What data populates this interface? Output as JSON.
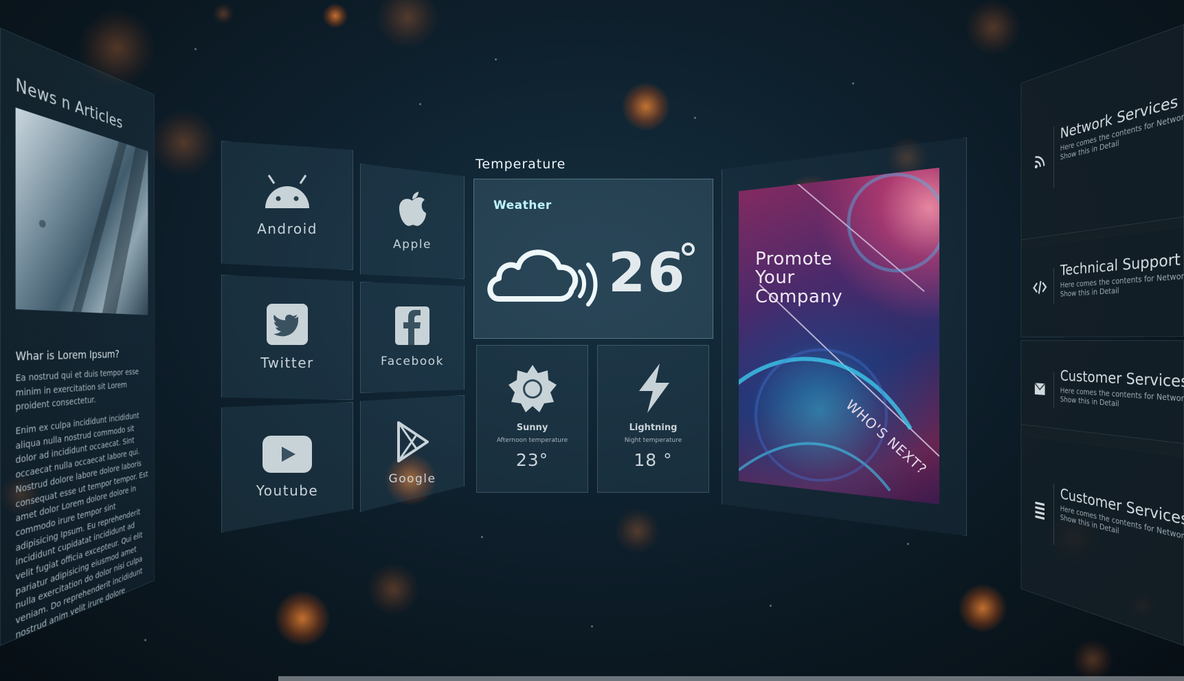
{
  "news": {
    "title": "News n Articles",
    "heading": "Whar is Lorem Ipsum?",
    "para1": "Ea nostrud qui et duis tempor esse minim in exercitation sit Lorem proident consectetur.",
    "para2": "Enim ex culpa incididunt incididunt aliqua nulla nostrud commodo sit dolor ad incididunt occaecat. Sint occaecat nulla occaecat labore qui. Nostrud dolore labore dolore laboris consequat esse ut tempor tempor. Est amet dolor Lorem dolore dolore in commodo irure tempor sint adipisicing Ipsum. Eu reprehenderit incididunt cupidatat incididunt ad velit fugiat officia excepteur. Qui elit pariatur adipisicing eiusmod amet nulla exercitation do dolor nisi culpa veniam. Do reprehenderit incididunt nostrud anim velit irure dolore"
  },
  "apps": [
    {
      "label": "Android",
      "icon": "android-icon"
    },
    {
      "label": "Apple",
      "icon": "apple-icon"
    },
    {
      "label": "Twitter",
      "icon": "twitter-icon"
    },
    {
      "label": "Facebook",
      "icon": "facebook-icon"
    },
    {
      "label": "Youtube",
      "icon": "youtube-icon"
    },
    {
      "label": "Google",
      "icon": "google-play-icon"
    }
  ],
  "temperature": {
    "section_label": "Temperature",
    "card_label": "Weather",
    "current": "26",
    "current_icon": "cloud-icon",
    "accent": "#bff3ff"
  },
  "forecast": [
    {
      "name": "Sunny",
      "sub": "Afternoon temperature",
      "value": "23°",
      "icon": "sun-icon"
    },
    {
      "name": "Lightning",
      "sub": "Night temperature",
      "value": "18 °",
      "icon": "lightning-icon"
    }
  ],
  "promo": {
    "line1": "Promote",
    "line2": "Your",
    "line3": "Company",
    "tagline": "WHO'S NEXT?"
  },
  "services": [
    {
      "title": "Network Services",
      "line1": "Here comes the contents for Network",
      "line2": "Show this in Detail",
      "icon": "rss-icon"
    },
    {
      "title": "Technical Support",
      "line1": "Here comes the contents for Network",
      "line2": "Show this in Detail",
      "icon": "code-icon"
    },
    {
      "title": "Customer Services",
      "line1": "Here comes the contents for Network",
      "line2": "Show this in Detail",
      "icon": "mail-icon"
    },
    {
      "title": "Customer Services",
      "line1": "Here comes the contents for Network",
      "line2": "Show this in Detail",
      "icon": "list-icon"
    }
  ]
}
